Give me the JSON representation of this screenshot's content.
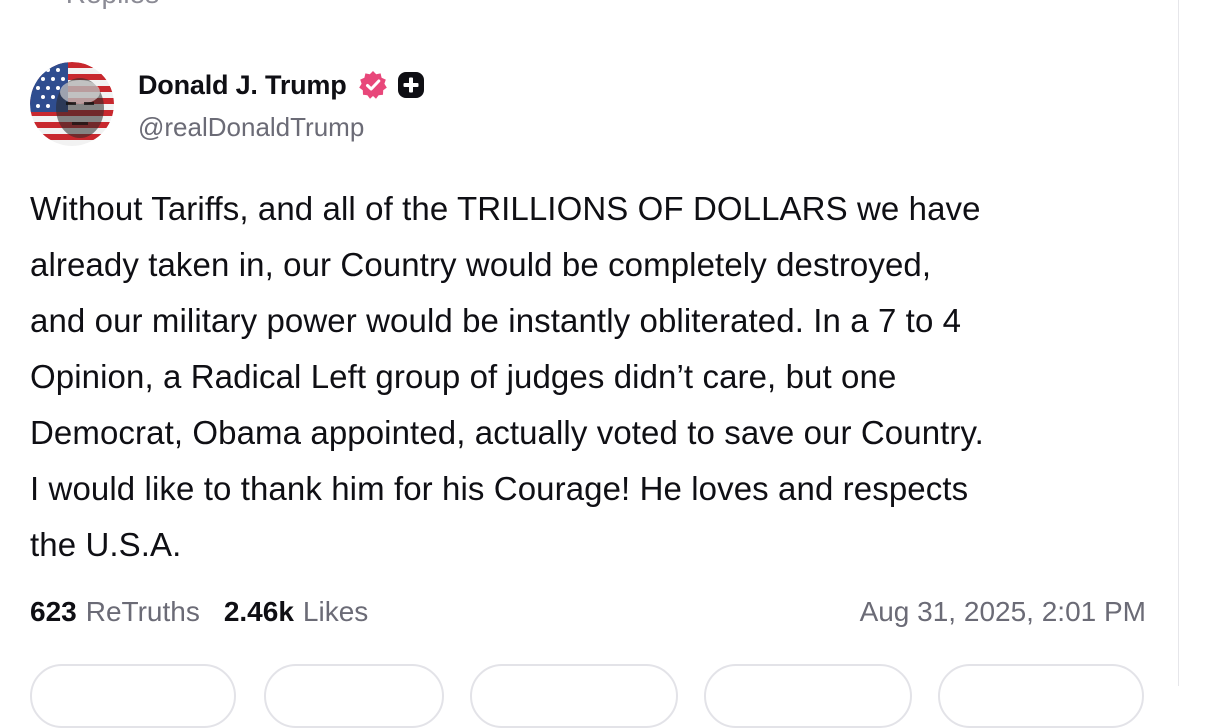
{
  "top_cut_text": "··· Replies",
  "author": {
    "display_name": "Donald J. Trump",
    "handle": "@realDonaldTrump",
    "verified_icon": "verified-badge-icon",
    "plus_icon": "plus-badge-icon",
    "accent_color": "#e8477a"
  },
  "post": {
    "text_lines": [
      "Without Tariffs, and all of the TRILLIONS OF DOLLARS we have",
      "already taken in, our Country would be completely destroyed,",
      "and our military power would be instantly obliterated. In a 7 to 4",
      "Opinion, a Radical Left group of judges didn’t care, but one",
      "Democrat, Obama appointed, actually voted to save our Country.",
      "I would like to thank him for his Courage! He loves and respects",
      "the U.S.A."
    ]
  },
  "stats": {
    "retruths_count": "623",
    "retruths_label": "ReTruths",
    "likes_count": "2.46k",
    "likes_label": "Likes",
    "timestamp": "Aug 31, 2025, 2:01 PM"
  },
  "actions": [
    "reply",
    "retruth",
    "like",
    "share",
    "more"
  ]
}
